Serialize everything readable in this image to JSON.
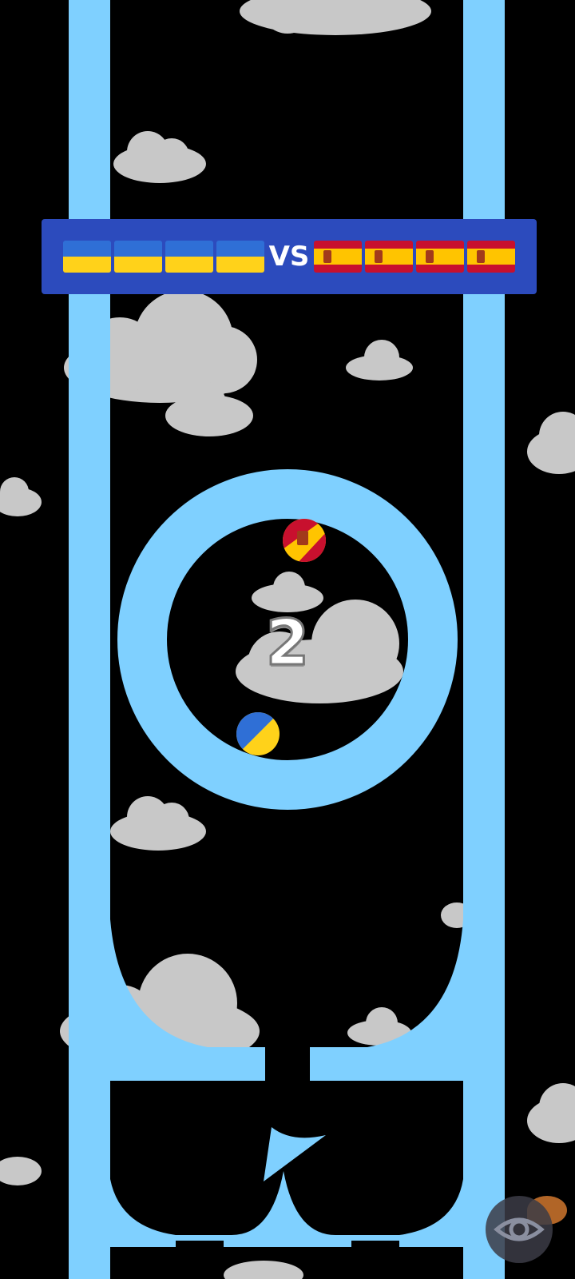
{
  "scoreboard": {
    "vs_label": "VS",
    "left_team": {
      "flag": "ukraine-flag",
      "count": 4
    },
    "right_team": {
      "flag": "spain-flag",
      "count": 4
    }
  },
  "countdown": {
    "value": "2"
  },
  "balls": [
    {
      "name": "spain-ball",
      "flag": "spain-flag"
    },
    {
      "name": "ukraine-ball",
      "flag": "ukraine-flag"
    }
  ],
  "colors": {
    "background": "#000000",
    "track": "#7fd0ff",
    "cloud": "#c8c8c8",
    "banner": "#2c4bbd"
  },
  "overlay": {
    "icon": "eye-icon"
  }
}
